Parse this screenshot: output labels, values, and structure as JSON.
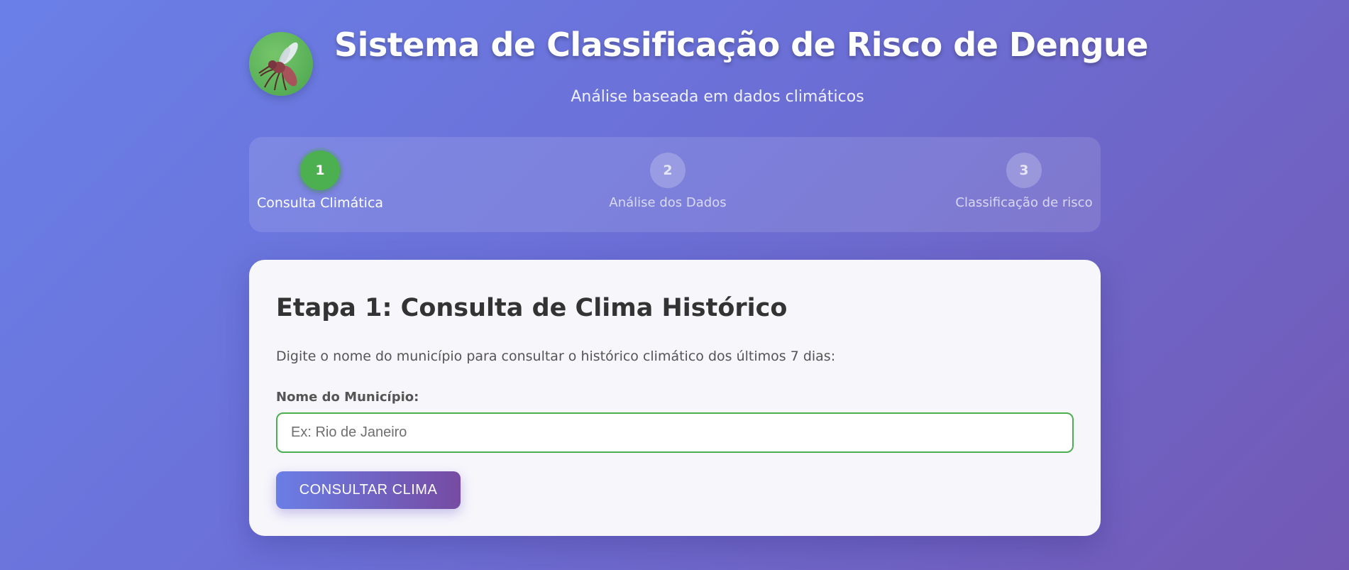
{
  "header": {
    "logo_icon": "mosquito-icon",
    "title": "Sistema de Classificação de Risco de Dengue",
    "subtitle": "Análise baseada em dados climáticos"
  },
  "steps": [
    {
      "number": "1",
      "label": "Consulta Climática",
      "active": true
    },
    {
      "number": "2",
      "label": "Análise dos Dados",
      "active": false
    },
    {
      "number": "3",
      "label": "Classificação de risco",
      "active": false
    }
  ],
  "card": {
    "title": "Etapa 1: Consulta de Clima Histórico",
    "description": "Digite o nome do município para consultar o histórico climático dos últimos 7 dias:",
    "field_label": "Nome do Município:",
    "input_value": "",
    "input_placeholder": "Ex: Rio de Janeiro",
    "button_label": "CONSULTAR CLIMA"
  },
  "colors": {
    "background_start": "#6a80e8",
    "background_end": "#7359b5",
    "active_step": "#4caf50",
    "input_border": "#4caf50",
    "button_start": "#6a7ee6",
    "button_end": "#764ba2"
  }
}
